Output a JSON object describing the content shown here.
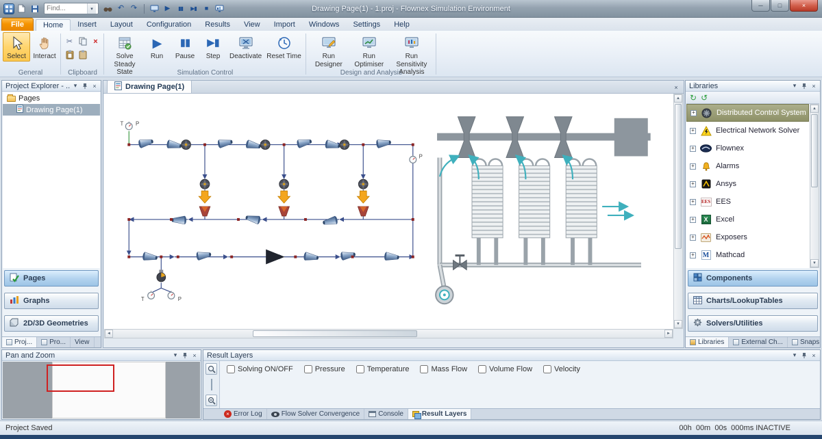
{
  "icons": {
    "caret_down": "▾",
    "close": "×",
    "minimize": "─",
    "maximize": "□",
    "up": "▲",
    "down": "▼",
    "left": "◄",
    "right": "►",
    "undo": "↶",
    "redo": "↷",
    "play": "▶",
    "pause": "▮▮",
    "step": "▶▮",
    "stop": "■",
    "refresh": "↻",
    "check": "✓",
    "scissors": "✂",
    "delete": "×",
    "plus": "+"
  },
  "window": {
    "title": "Drawing Page(1) - 1.proj - Flownex Simulation Environment",
    "find_value": "Find..."
  },
  "ribbon": {
    "file_tab": "File",
    "tabs": [
      "Home",
      "Insert",
      "Layout",
      "Configuration",
      "Results",
      "View",
      "Import",
      "Windows",
      "Settings",
      "Help"
    ],
    "groups": {
      "general": {
        "label": "General",
        "select": "Select",
        "interact": "Interact"
      },
      "clipboard": {
        "label": "Clipboard"
      },
      "simulation": {
        "label": "Simulation Control",
        "buttons": [
          "Solve Steady State",
          "Run",
          "Pause",
          "Step",
          "Deactivate",
          "Reset Time"
        ]
      },
      "design": {
        "label": "Design and Analysis",
        "buttons": [
          "Run Designer",
          "Run Optimiser",
          "Run Sensitivity Analysis"
        ]
      }
    }
  },
  "project_explorer": {
    "title": "Project Explorer - ...",
    "root_item": "Pages",
    "selected_item": "Drawing Page(1)",
    "nav_buttons": [
      "Pages",
      "Graphs",
      "2D/3D Geometries"
    ],
    "tabs": [
      "Proj...",
      "Pro...",
      "View"
    ]
  },
  "canvas": {
    "tab_label": "Drawing Page(1)",
    "labels": {
      "t": "T",
      "p": "P"
    }
  },
  "libraries": {
    "title": "Libraries",
    "items": [
      "Distributed Control System",
      "Electrical Network Solver",
      "Flownex",
      "Alarms",
      "Ansys",
      "EES",
      "Excel",
      "Exposers",
      "Mathcad"
    ],
    "icon_letters": {
      "ees": "EES",
      "excel": "X",
      "mathcad": "M"
    },
    "nav_buttons": [
      "Components",
      "Charts/LookupTables",
      "Solvers/Utilities"
    ],
    "tabs": [
      "Libraries",
      "External Ch...",
      "Snaps"
    ]
  },
  "pan_zoom": {
    "title": "Pan and Zoom"
  },
  "result_layers": {
    "title": "Result Layers",
    "checkboxes": [
      "Solving ON/OFF",
      "Pressure",
      "Temperature",
      "Mass Flow",
      "Volume Flow",
      "Velocity"
    ],
    "tabs": [
      "Error Log",
      "Flow Solver Convergence",
      "Console",
      "Result Layers"
    ]
  },
  "status_bar": {
    "left": "Project Saved",
    "right": "00h  00m  00s  000ms INACTIVE"
  }
}
